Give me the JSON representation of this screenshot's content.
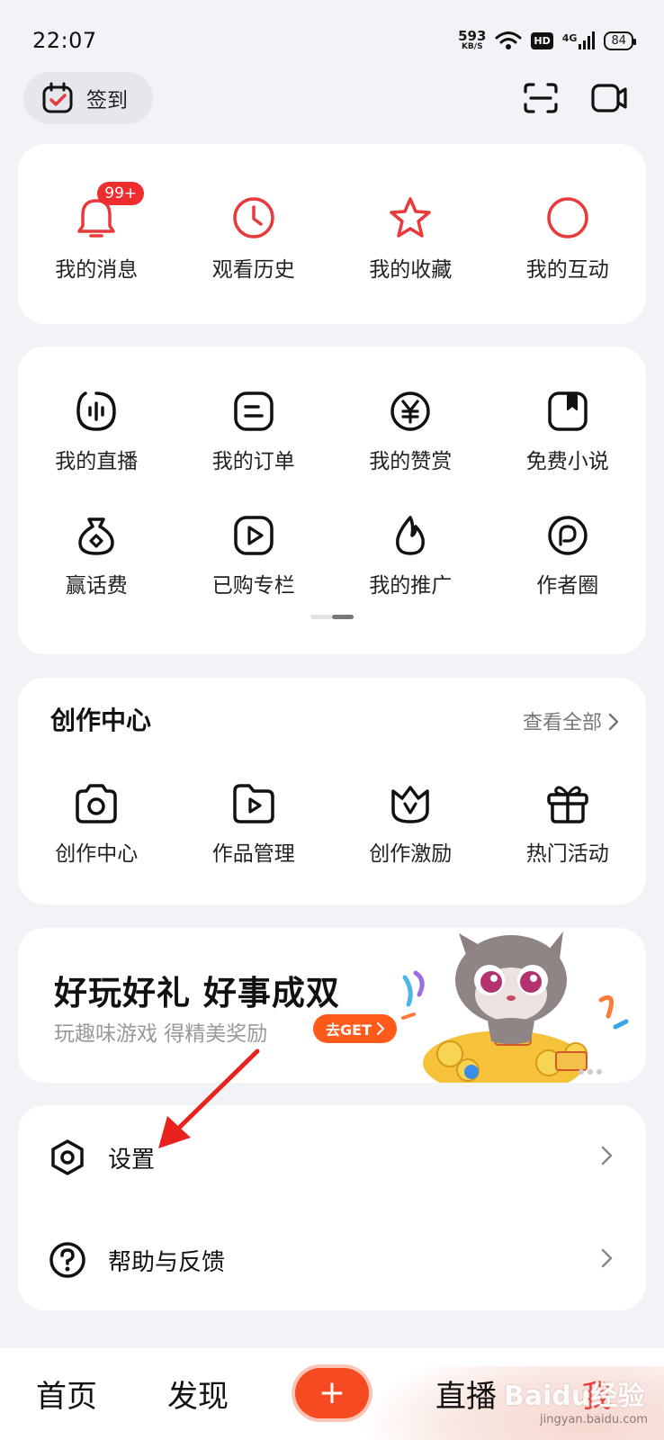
{
  "status_bar": {
    "time": "22:07",
    "net_speed": "593",
    "net_unit": "KB/S",
    "hd": "HD",
    "signal": "4G",
    "battery": "84"
  },
  "header": {
    "checkin_label": "签到"
  },
  "quick_actions": [
    {
      "label": "我的消息",
      "icon": "bell-icon",
      "badge": "99+"
    },
    {
      "label": "观看历史",
      "icon": "clock-icon"
    },
    {
      "label": "我的收藏",
      "icon": "star-icon"
    },
    {
      "label": "我的互动",
      "icon": "circle-icon"
    }
  ],
  "services": [
    {
      "label": "我的直播",
      "icon": "live-icon"
    },
    {
      "label": "我的订单",
      "icon": "order-icon"
    },
    {
      "label": "我的赞赏",
      "icon": "yen-icon"
    },
    {
      "label": "免费小说",
      "icon": "book-icon"
    },
    {
      "label": "赢话费",
      "icon": "money-bag-icon"
    },
    {
      "label": "已购专栏",
      "icon": "play-square-icon"
    },
    {
      "label": "我的推广",
      "icon": "flame-icon"
    },
    {
      "label": "作者圈",
      "icon": "author-circle-icon"
    }
  ],
  "creation": {
    "title": "创作中心",
    "see_all": "查看全部",
    "items": [
      {
        "label": "创作中心",
        "icon": "camera-icon"
      },
      {
        "label": "作品管理",
        "icon": "folder-play-icon"
      },
      {
        "label": "创作激励",
        "icon": "crown-icon"
      },
      {
        "label": "热门活动",
        "icon": "gift-icon"
      }
    ]
  },
  "banner": {
    "title": "好玩好礼 好事成双",
    "subtitle": "玩趣味游戏 得精美奖励",
    "button": "去GET"
  },
  "menu": [
    {
      "label": "设置",
      "icon": "settings-icon"
    },
    {
      "label": "帮助与反馈",
      "icon": "help-icon"
    }
  ],
  "bottom_nav": {
    "home": "首页",
    "discover": "发现",
    "plus": "+",
    "live": "直播",
    "me": "我"
  },
  "watermark": "Baidu经验",
  "watermark_sub": "jingyan.baidu.com",
  "colors": {
    "accent_red": "#e83a3a",
    "orange": "#f54a22",
    "background": "#f2f3f7"
  }
}
